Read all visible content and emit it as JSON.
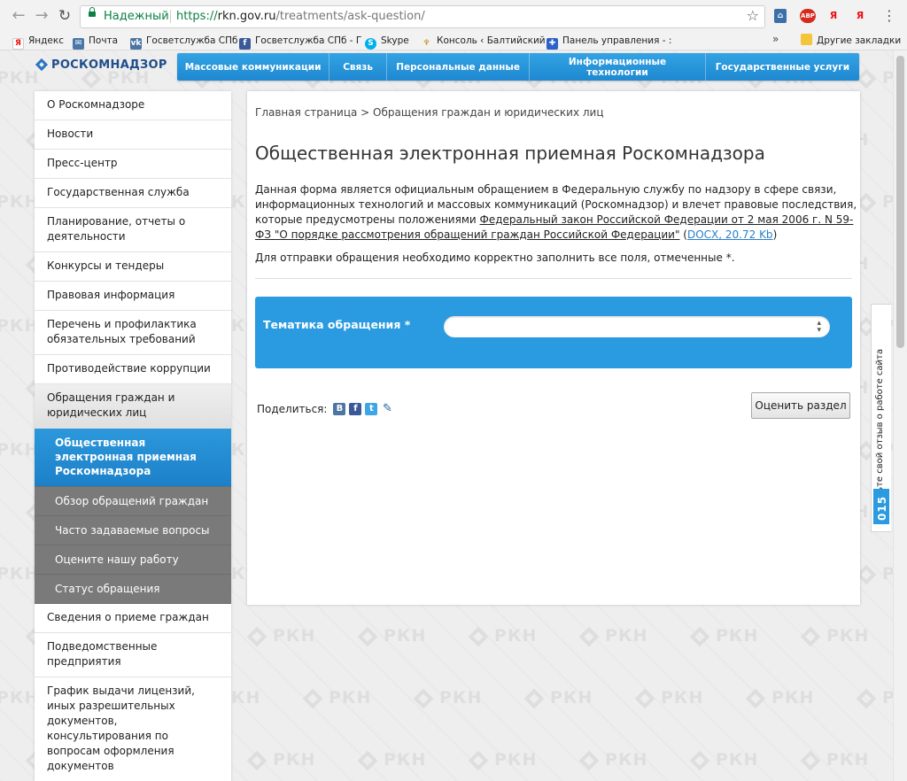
{
  "browser": {
    "security_label": "Надежный",
    "url_scheme": "https://",
    "url_host": "rkn.gov.ru",
    "url_path": "/treatments/ask-question/",
    "ext_cast": "⌂",
    "ext_abp": "ABP",
    "ext_ya1": "Я",
    "ext_ya2": "Я",
    "bookmarks": [
      {
        "label": "Яндекс",
        "icon": "yandex-icon",
        "color": "#ffffff"
      },
      {
        "label": "Почта",
        "icon": "mail-icon",
        "color": "#4a76a8"
      },
      {
        "label": "Госветслужба СПб",
        "icon": "vk-icon",
        "color": "#4c75a3"
      },
      {
        "label": "Госветслужба СПб - Г",
        "icon": "facebook-icon",
        "color": "#3b5998"
      },
      {
        "label": "Skype",
        "icon": "skype-icon",
        "color": "#00aff0"
      },
      {
        "label": "Консоль ‹ Балтийский",
        "icon": "console-icon",
        "color": "#e0b020"
      },
      {
        "label": "Панель управления - :",
        "icon": "panel-icon",
        "color": "#2a62c9"
      }
    ],
    "other_bookmarks": "Другие закладки"
  },
  "site": {
    "logo": "РОСКОМНАДЗОР",
    "watermark": "РКН",
    "topnav": [
      "Массовые коммуникации",
      "Связь",
      "Персональные данные",
      "Информационные технологии",
      "Государственные услуги"
    ]
  },
  "sidebar": {
    "items_top": [
      "О Роскомнадзоре",
      "Новости",
      "Пресс-центр",
      "Государственная служба",
      "Планирование, отчеты о деятельности",
      "Конкурсы и тендеры",
      "Правовая информация",
      "Перечень и профилактика обязательных требований",
      "Противодействие коррупции"
    ],
    "section": "Обращения граждан и юридических лиц",
    "subitems": [
      "Общественная электронная приемная Роскомнадзора",
      "Обзор обращений граждан",
      "Часто задаваемые вопросы",
      "Оцените нашу работу",
      "Статус обращения"
    ],
    "items_bottom": [
      "Сведения о приеме граждан",
      "Подведомственные предприятия",
      "График выдачи лицензий, иных разрешительных документов, консультирования по вопросам оформления документов"
    ]
  },
  "content": {
    "breadcrumb": "Главная страница > Обращения граждан и юридических лиц",
    "title": "Общественная электронная приемная Роскомнадзора",
    "intro_text": "Данная форма является официальным обращением в Федеральную службу по надзору в сфере связи, информационных технологий и массовых коммуникаций (Роскомнадзор) и влечет правовые последствия, которые предусмотрены положениями ",
    "intro_link": "Федеральный закон Российской Федерации от 2 мая 2006 г. N 59-ФЗ \"О порядке рассмотрения обращений граждан Российской Федерации\"",
    "intro_file": "DOCX, 20.72 Kb",
    "note": "Для отправки обращения необходимо корректно заполнить все поля, отмеченные *.",
    "form": {
      "topic_label": "Тематика обращения *",
      "topic_value": ""
    },
    "share_label": "Поделиться:",
    "social": {
      "vk": "В",
      "fb": "f",
      "tw": "t",
      "lj": "✎"
    },
    "rate_button": "Оценить раздел"
  },
  "feedback_tab": {
    "text": "Оставьте свой отзыв о работе сайта",
    "counter": "015"
  }
}
